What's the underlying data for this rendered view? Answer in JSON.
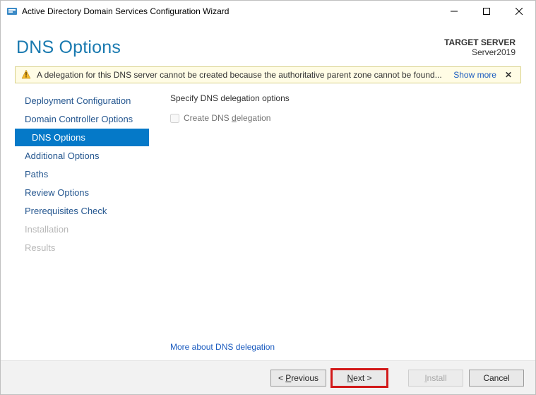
{
  "window": {
    "title": "Active Directory Domain Services Configuration Wizard"
  },
  "header": {
    "page_title": "DNS Options",
    "target_label": "TARGET SERVER",
    "target_value": "Server2019"
  },
  "banner": {
    "text": "A delegation for this DNS server cannot be created because the authoritative parent zone cannot be found...",
    "show_more": "Show more"
  },
  "nav": {
    "items": [
      {
        "label": "Deployment Configuration",
        "state": "normal"
      },
      {
        "label": "Domain Controller Options",
        "state": "normal"
      },
      {
        "label": "DNS Options",
        "state": "active"
      },
      {
        "label": "Additional Options",
        "state": "normal"
      },
      {
        "label": "Paths",
        "state": "normal"
      },
      {
        "label": "Review Options",
        "state": "normal"
      },
      {
        "label": "Prerequisites Check",
        "state": "normal"
      },
      {
        "label": "Installation",
        "state": "disabled"
      },
      {
        "label": "Results",
        "state": "disabled"
      }
    ]
  },
  "content": {
    "heading": "Specify DNS delegation options",
    "checkbox_label_pre": "Create DNS ",
    "checkbox_label_u": "d",
    "checkbox_label_post": "elegation",
    "more_link": "More about DNS delegation"
  },
  "footer": {
    "previous_pre": "< ",
    "previous_u": "P",
    "previous_post": "revious",
    "next_u": "N",
    "next_post": "ext >",
    "install_u": "I",
    "install_post": "nstall",
    "cancel": "Cancel"
  }
}
